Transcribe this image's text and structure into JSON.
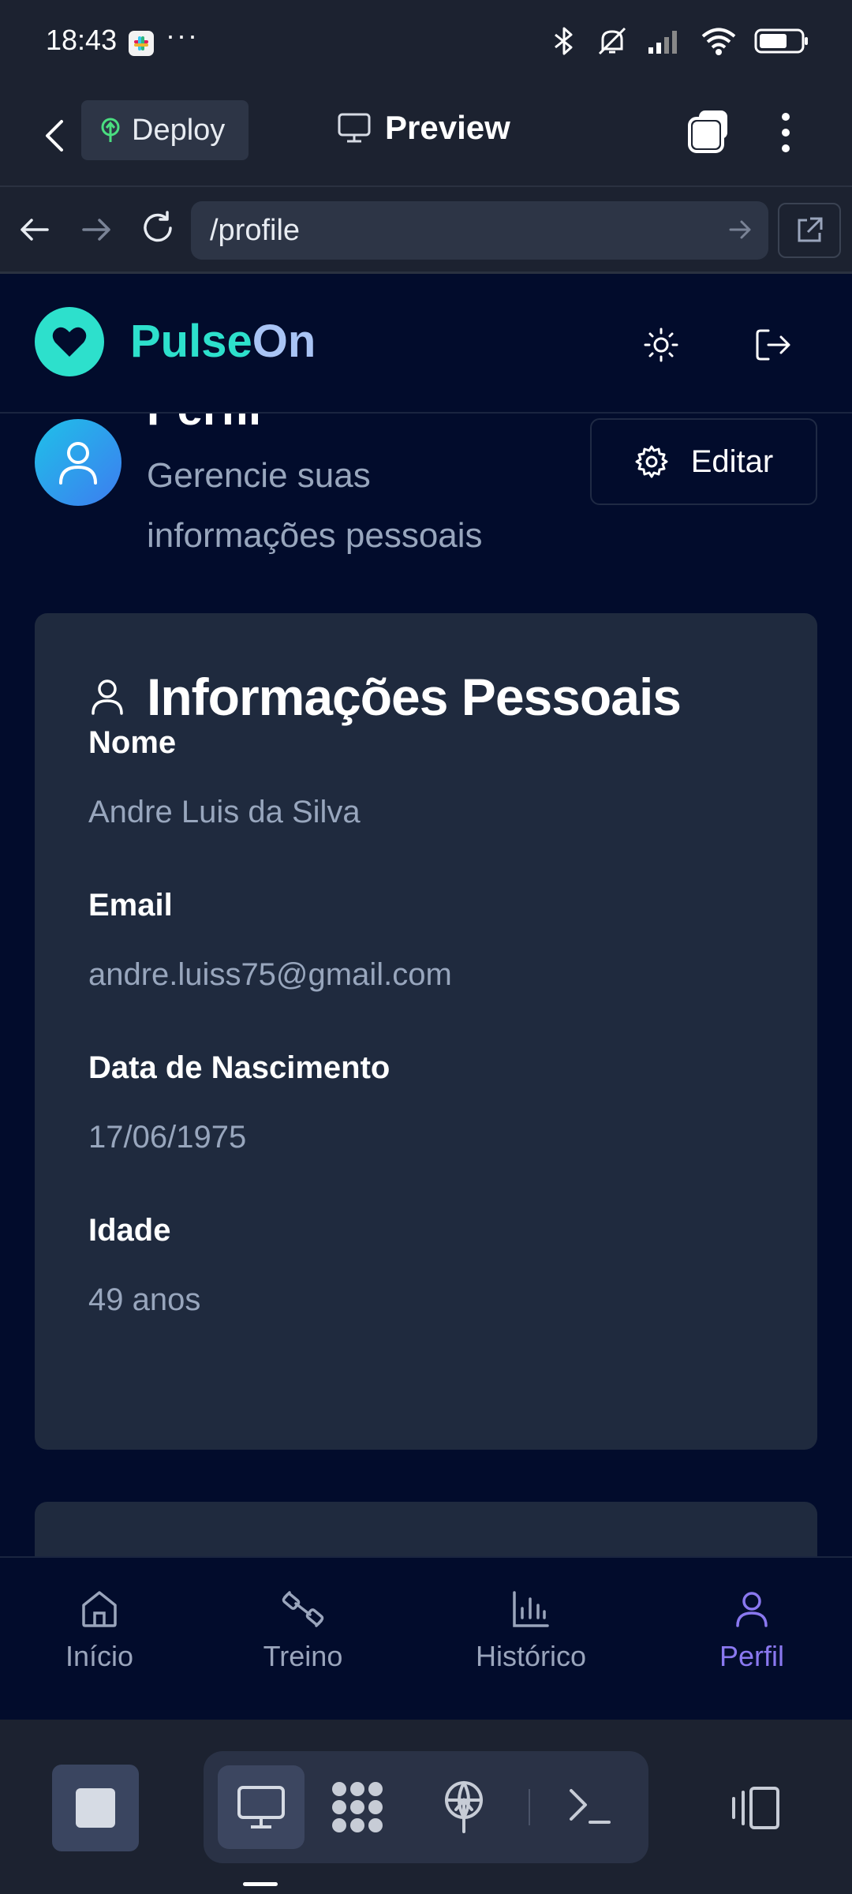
{
  "status_bar": {
    "time": "18:43",
    "overflow": "···",
    "icons": [
      "slack-icon",
      "bluetooth-icon",
      "mute-icon",
      "signal-icon",
      "wifi-icon",
      "battery-icon"
    ]
  },
  "app_header": {
    "deploy_label": "Deploy",
    "preview_label": "Preview"
  },
  "url_bar": {
    "url": "/profile"
  },
  "site": {
    "logo_part1": "Pulse",
    "logo_part2": "On",
    "accent": "#2de0cc"
  },
  "profile": {
    "title": "Perfil",
    "subtitle": "Gerencie suas informações pessoais",
    "edit_label": "Editar"
  },
  "personal_info": {
    "title": "Informações Pessoais",
    "fields": [
      {
        "label": "Nome",
        "value": "Andre Luis da Silva"
      },
      {
        "label": "Email",
        "value": "andre.luiss75@gmail.com"
      },
      {
        "label": "Data de Nascimento",
        "value": "17/06/1975"
      },
      {
        "label": "Idade",
        "value": "49 anos"
      }
    ]
  },
  "bottom_nav": {
    "items": [
      {
        "label": "Início",
        "icon": "home-icon"
      },
      {
        "label": "Treino",
        "icon": "dumbbell-icon"
      },
      {
        "label": "Histórico",
        "icon": "bar-chart-icon"
      },
      {
        "label": "Perfil",
        "icon": "user-icon",
        "active": true
      }
    ],
    "active_color": "#8a78f0"
  }
}
